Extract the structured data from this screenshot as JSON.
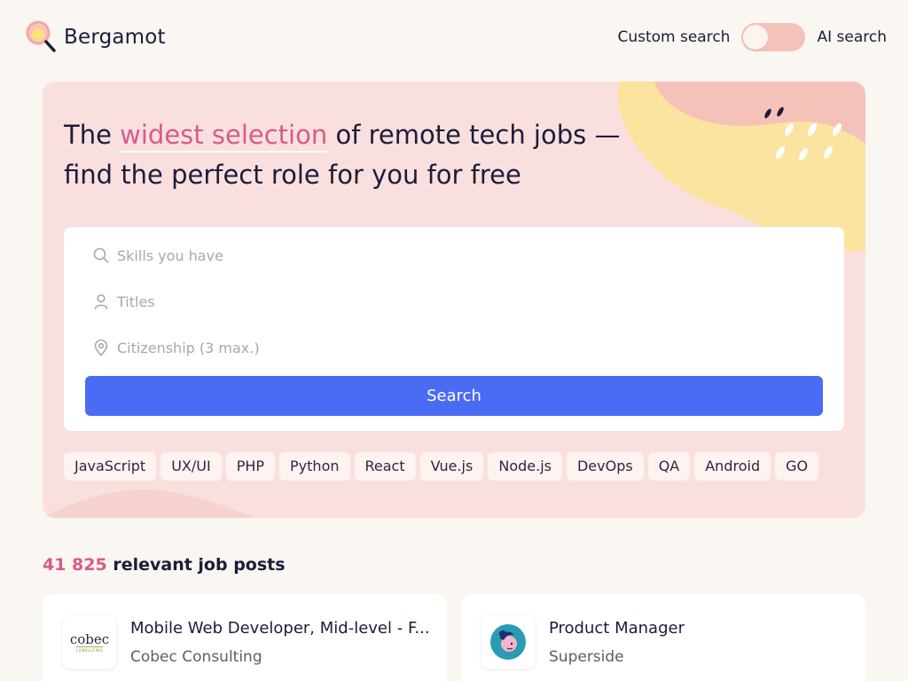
{
  "brand": {
    "name": "Bergamot",
    "colors": {
      "accent": "#d85a8c",
      "primary": "#4a6cf4",
      "hero_bg": "#f9e0de",
      "page_bg": "#faf6f2",
      "toggle": "#f5c2b9",
      "deco_yellow": "#fbe3a0"
    }
  },
  "header": {
    "toggle_left_label": "Custom search",
    "toggle_right_label": "AI search",
    "toggle_state": "custom"
  },
  "hero": {
    "title_before": "The ",
    "title_highlight": "widest selection",
    "title_after": " of remote tech jobs — find the perfect role for you for free"
  },
  "search": {
    "skills_placeholder": "Skills you have",
    "titles_placeholder": "Titles",
    "citizenship_placeholder": "Citizenship (3 max.)",
    "button_label": "Search",
    "icons": [
      "search-icon",
      "person-icon",
      "location-pin-icon"
    ]
  },
  "tags": [
    "JavaScript",
    "UX/UI",
    "PHP",
    "Python",
    "React",
    "Vue.js",
    "Node.js",
    "DevOps",
    "QA",
    "Android",
    "GO"
  ],
  "results": {
    "count": "41 825",
    "label": " relevant job posts"
  },
  "jobs": [
    {
      "title": "Mobile Web Developer, Mid-level - F...",
      "company": "Cobec Consulting",
      "logo_text": "cobec",
      "logo_subtext": "CONSULTING"
    },
    {
      "title": "Product Manager",
      "company": "Superside",
      "logo_icon": "superside-avatar-icon"
    }
  ]
}
